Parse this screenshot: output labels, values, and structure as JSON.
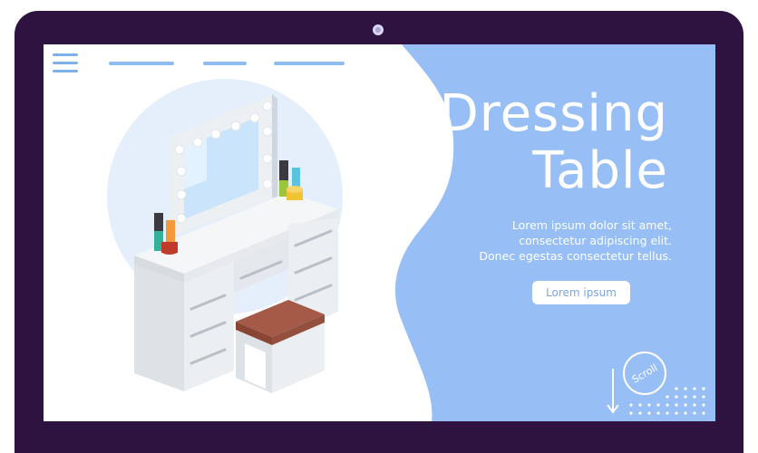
{
  "screen": {
    "menu_icon": "hamburger-menu-icon",
    "nav_links": [
      "",
      "",
      ""
    ],
    "title_line1": "Dressing",
    "title_line2": "Table",
    "description": [
      "Lorem ipsum dolor sit amet,",
      "consectetur adipiscing elit.",
      "Donec egestas consectetur tellus."
    ],
    "cta_label": "Lorem ipsum",
    "scroll_label": "Scroll",
    "scroll_icon": "arrow-down-icon"
  },
  "colors": {
    "frame": "#2e1240",
    "accent_blue": "#97bff5",
    "screen_bg": "#ffffff",
    "cta_text": "#7aa6e3",
    "stool_seat": "#a55a47"
  }
}
